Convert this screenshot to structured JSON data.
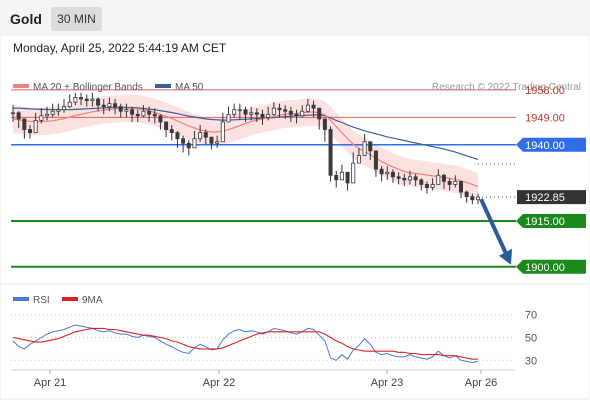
{
  "header": {
    "title": "Gold",
    "timeframe": "30 MIN"
  },
  "timestamp": "Monday, April 25, 2022 5:44:19 AM CET",
  "legend": {
    "ma20_label": "MA 20 + Bollinger Bands",
    "ma50_label": "MA 50",
    "rsi_label": "RSI",
    "rsi_ma_label": "9MA"
  },
  "watermark": "Research © 2022 Trading Central",
  "colors": {
    "ma20": "#f08080",
    "band_fill": "#fcdcdc",
    "ma50": "#3a5f95",
    "resistance": "#e06060",
    "pivot": "#2f6ee8",
    "support": "#1a8a1a",
    "price_tag": "#333333",
    "arrow": "#2a5a9c",
    "rsi": "#4a7ad8",
    "rsi_ma": "#e02020"
  },
  "chart_data": {
    "type": "line",
    "instrument": "Gold",
    "timeframe": "30 MIN",
    "x_ticks": [
      "Apr 21",
      "Apr 22",
      "Apr 23",
      "Apr 26"
    ],
    "ylim": [
      1897,
      1962
    ],
    "levels": [
      {
        "name": "resistance",
        "value": 1958.0,
        "label": "1958.00"
      },
      {
        "name": "resistance",
        "value": 1949.0,
        "label": "1949.00"
      },
      {
        "name": "pivot",
        "value": 1940.0,
        "label": "1940.00"
      },
      {
        "name": "last_price",
        "value": 1922.85,
        "label": "1922.85"
      },
      {
        "name": "support",
        "value": 1915.0,
        "label": "1915.00"
      },
      {
        "name": "support",
        "value": 1900.0,
        "label": "1900.00"
      }
    ],
    "forecast": {
      "from": 1922.85,
      "to": 1900.0,
      "direction": "down"
    },
    "price_close": [
      1950.5,
      1948.5,
      1945.0,
      1944.0,
      1948.0,
      1949.5,
      1950.0,
      1951.0,
      1951.5,
      1952.5,
      1954.0,
      1955.5,
      1955.0,
      1954.5,
      1955.0,
      1953.0,
      1952.5,
      1953.5,
      1952.5,
      1951.0,
      1951.5,
      1950.0,
      1949.5,
      1951.0,
      1950.0,
      1949.5,
      1947.5,
      1945.0,
      1944.0,
      1942.0,
      1940.5,
      1939.0,
      1942.0,
      1944.0,
      1942.5,
      1940.5,
      1941.0,
      1947.5,
      1950.0,
      1951.5,
      1951.5,
      1950.0,
      1950.5,
      1950.0,
      1949.0,
      1950.0,
      1952.0,
      1951.5,
      1951.0,
      1950.0,
      1949.5,
      1951.0,
      1953.0,
      1952.0,
      1948.5,
      1945.0,
      1930.0,
      1928.5,
      1931.0,
      1927.5,
      1934.0,
      1936.5,
      1941.0,
      1938.0,
      1932.0,
      1930.5,
      1931.0,
      1929.5,
      1929.0,
      1928.5,
      1929.5,
      1928.5,
      1927.0,
      1926.0,
      1927.0,
      1930.0,
      1928.0,
      1927.0,
      1928.0,
      1924.5,
      1923.0,
      1922.0,
      1922.85
    ],
    "price_low": [
      1947.5,
      1945.5,
      1942.0,
      1942.0,
      1946.0,
      1947.0,
      1948.0,
      1949.0,
      1949.5,
      1950.5,
      1952.0,
      1953.0,
      1953.0,
      1952.5,
      1952.5,
      1951.0,
      1950.0,
      1951.0,
      1950.0,
      1949.0,
      1949.0,
      1947.5,
      1947.5,
      1949.0,
      1947.5,
      1947.0,
      1945.0,
      1942.5,
      1941.5,
      1939.0,
      1937.5,
      1936.5,
      1939.5,
      1941.0,
      1940.0,
      1938.5,
      1939.0,
      1945.0,
      1947.5,
      1949.0,
      1948.5,
      1947.5,
      1948.0,
      1947.5,
      1946.5,
      1948.0,
      1949.5,
      1949.0,
      1948.5,
      1947.5,
      1947.0,
      1949.0,
      1950.5,
      1949.0,
      1945.0,
      1941.0,
      1928.0,
      1926.0,
      1928.5,
      1925.0,
      1931.0,
      1934.0,
      1938.5,
      1935.0,
      1929.5,
      1928.0,
      1928.5,
      1927.5,
      1927.0,
      1926.5,
      1927.0,
      1926.5,
      1925.0,
      1924.0,
      1925.0,
      1927.5,
      1925.5,
      1925.0,
      1926.0,
      1922.5,
      1921.0,
      1920.5,
      1920.5
    ],
    "price_high": [
      1953.0,
      1951.0,
      1948.0,
      1946.5,
      1950.5,
      1952.0,
      1952.5,
      1953.5,
      1953.5,
      1955.0,
      1956.5,
      1957.0,
      1957.0,
      1956.5,
      1957.0,
      1955.5,
      1955.0,
      1955.5,
      1955.0,
      1953.5,
      1953.5,
      1952.5,
      1951.5,
      1953.0,
      1952.5,
      1952.0,
      1950.0,
      1947.5,
      1946.5,
      1944.5,
      1943.0,
      1941.5,
      1944.5,
      1946.5,
      1945.0,
      1942.5,
      1943.0,
      1950.5,
      1952.5,
      1953.5,
      1953.5,
      1952.5,
      1952.5,
      1952.0,
      1951.5,
      1952.5,
      1954.0,
      1953.5,
      1953.0,
      1952.5,
      1951.5,
      1953.0,
      1955.0,
      1954.5,
      1951.0,
      1948.0,
      1946.0,
      1931.5,
      1933.5,
      1930.0,
      1937.5,
      1939.0,
      1943.5,
      1941.0,
      1935.0,
      1933.0,
      1933.0,
      1932.0,
      1931.0,
      1930.5,
      1931.5,
      1930.5,
      1929.0,
      1928.0,
      1929.0,
      1932.0,
      1930.5,
      1929.0,
      1930.0,
      1928.0,
      1925.0,
      1924.0,
      1924.0
    ],
    "ma20": [
      1948.5,
      1948.2,
      1947.9,
      1947.7,
      1947.6,
      1947.6,
      1947.7,
      1947.9,
      1948.2,
      1948.6,
      1949.1,
      1949.6,
      1950.0,
      1950.4,
      1950.8,
      1951.1,
      1951.4,
      1951.6,
      1951.8,
      1951.9,
      1952.0,
      1951.9,
      1951.8,
      1951.5,
      1951.1,
      1950.6,
      1950.0,
      1949.3,
      1948.6,
      1947.8,
      1947.0,
      1946.2,
      1945.5,
      1944.9,
      1944.5,
      1944.2,
      1944.2,
      1944.5,
      1945.0,
      1945.6,
      1946.3,
      1947.0,
      1947.6,
      1948.1,
      1948.5,
      1948.9,
      1949.3,
      1949.7,
      1950.0,
      1950.2,
      1950.3,
      1950.5,
      1950.7,
      1950.8,
      1950.5,
      1949.8,
      1948.0,
      1946.0,
      1944.0,
      1942.0,
      1940.2,
      1938.8,
      1937.8,
      1936.8,
      1935.6,
      1934.5,
      1933.6,
      1932.8,
      1932.0,
      1931.2,
      1930.8,
      1930.6,
      1930.4,
      1930.1,
      1929.8,
      1929.6,
      1929.3,
      1929.0,
      1928.7,
      1928.2,
      1927.6,
      1927.0,
      1926.3
    ],
    "ma50": [
      1952.0,
      1952.0,
      1951.9,
      1951.8,
      1951.7,
      1951.6,
      1951.6,
      1951.5,
      1951.5,
      1951.5,
      1951.5,
      1951.6,
      1951.7,
      1951.8,
      1951.9,
      1952.0,
      1952.1,
      1952.2,
      1952.3,
      1952.3,
      1952.3,
      1952.2,
      1952.1,
      1951.9,
      1951.7,
      1951.5,
      1951.2,
      1950.9,
      1950.6,
      1950.2,
      1949.8,
      1949.4,
      1949.1,
      1948.8,
      1948.5,
      1948.3,
      1948.2,
      1948.1,
      1948.1,
      1948.2,
      1948.3,
      1948.4,
      1948.5,
      1948.6,
      1948.7,
      1948.8,
      1948.9,
      1949.1,
      1949.2,
      1949.4,
      1949.5,
      1949.6,
      1949.7,
      1949.8,
      1949.8,
      1949.5,
      1948.8,
      1948.0,
      1947.3,
      1946.5,
      1945.8,
      1945.2,
      1944.6,
      1944.1,
      1943.6,
      1943.1,
      1942.6,
      1942.2,
      1941.8,
      1941.4,
      1941.0,
      1940.6,
      1940.2,
      1939.8,
      1939.4,
      1939.0,
      1938.6,
      1938.1,
      1937.6,
      1937.0,
      1936.4,
      1935.8,
      1935.2
    ],
    "bb_width": 4.5,
    "rsi": {
      "ylim": [
        25,
        75
      ],
      "ticks": [
        70,
        50,
        30
      ],
      "values": [
        47,
        42,
        40,
        44,
        47,
        50,
        53,
        55,
        56,
        57,
        59,
        61,
        60,
        59,
        58,
        56,
        55,
        56,
        54,
        53,
        53,
        51,
        50,
        52,
        51,
        50,
        47,
        44,
        42,
        39,
        37,
        36,
        41,
        44,
        42,
        39,
        40,
        48,
        53,
        56,
        57,
        55,
        56,
        55,
        53,
        55,
        58,
        57,
        56,
        54,
        53,
        55,
        58,
        57,
        52,
        47,
        32,
        30,
        35,
        31,
        39,
        43,
        49,
        44,
        37,
        35,
        36,
        34,
        33,
        33,
        35,
        33,
        32,
        31,
        33,
        38,
        34,
        32,
        34,
        30,
        29,
        28,
        29
      ],
      "ma9": [
        50,
        49,
        48,
        47,
        46,
        46,
        47,
        48,
        49,
        51,
        53,
        55,
        56,
        57,
        58,
        58,
        58,
        57,
        57,
        56,
        55,
        54,
        53,
        52,
        52,
        51,
        50,
        49,
        47,
        46,
        44,
        42,
        41,
        40,
        40,
        40,
        40,
        41,
        43,
        45,
        47,
        49,
        51,
        53,
        54,
        55,
        55,
        55,
        55,
        55,
        55,
        55,
        55,
        55,
        55,
        53,
        50,
        47,
        45,
        42,
        40,
        39,
        38,
        38,
        38,
        38,
        38,
        38,
        37,
        37,
        36,
        36,
        35,
        35,
        35,
        35,
        34,
        34,
        34,
        33,
        32,
        31,
        31
      ]
    }
  }
}
